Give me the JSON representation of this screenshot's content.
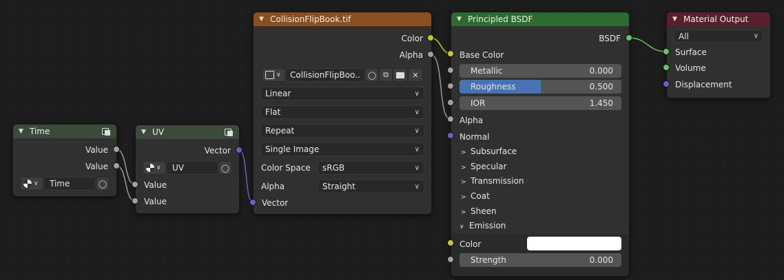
{
  "colors": {
    "header_time": "#3c4a3c",
    "header_uv": "#3c4a3c",
    "header_image": "#8a4e1f",
    "header_bsdf": "#2b6b2f",
    "header_output": "#5a1f2d",
    "socket_grey": "#a1a1a1",
    "socket_yellow": "#c7c729",
    "socket_purple": "#6363c7",
    "socket_green": "#63c763"
  },
  "time_node": {
    "title": "Time",
    "outputs": [
      "Value",
      "Value"
    ],
    "datablock_name": "Time"
  },
  "uv_node": {
    "title": "UV",
    "output": "Vector",
    "datablock_name": "UV",
    "inputs": [
      "Value",
      "Value"
    ]
  },
  "image_node": {
    "title": "CollisionFlipBook.tif",
    "outputs": [
      "Color",
      "Alpha"
    ],
    "image_name": "CollisionFlipBoo...",
    "interpolation": "Linear",
    "projection": "Flat",
    "extension": "Repeat",
    "source": "Single Image",
    "color_space_label": "Color Space",
    "color_space": "sRGB",
    "alpha_label": "Alpha",
    "alpha_mode": "Straight",
    "input": "Vector"
  },
  "bsdf_node": {
    "title": "Principled BSDF",
    "output": "BSDF",
    "base_color": "Base Color",
    "metallic_label": "Metallic",
    "metallic_value": "0.000",
    "roughness_label": "Roughness",
    "roughness_value": "0.500",
    "roughness_fraction": 0.5,
    "ior_label": "IOR",
    "ior_value": "1.450",
    "alpha": "Alpha",
    "normal": "Normal",
    "panels": [
      "Subsurface",
      "Specular",
      "Transmission",
      "Coat",
      "Sheen",
      "Emission"
    ],
    "emission_color_label": "Color",
    "emission_color": "#ffffff",
    "strength_label": "Strength",
    "strength_value": "0.000"
  },
  "output_node": {
    "title": "Material Output",
    "target": "All",
    "inputs": [
      "Surface",
      "Volume",
      "Displacement"
    ]
  }
}
